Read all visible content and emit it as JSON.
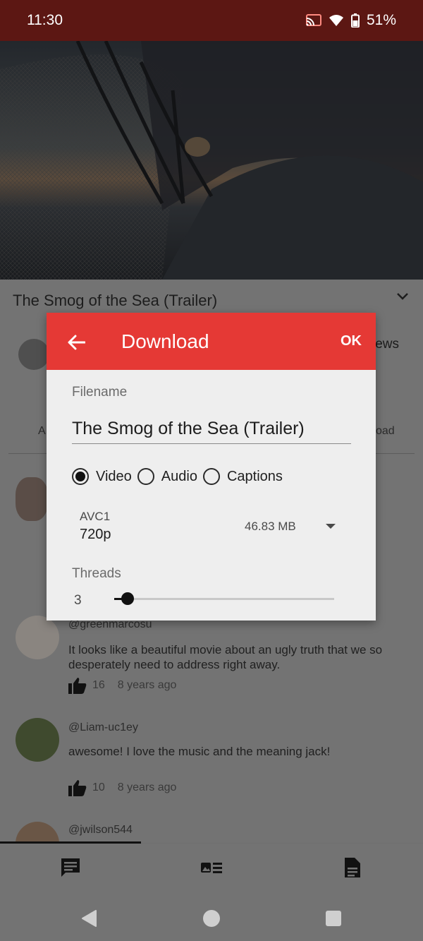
{
  "status_bar": {
    "time": "11:30",
    "battery": "51%",
    "icons": [
      "cast-icon",
      "wifi-icon",
      "battery-icon"
    ]
  },
  "video": {
    "title": "The Smog of the Sea (Trailer)",
    "views_fragment": "iews",
    "left_fragment": "A",
    "right_fragment": "oad"
  },
  "dialog": {
    "title": "Download",
    "ok_label": "OK",
    "filename_label": "Filename",
    "filename_value": "The Smog of the Sea (Trailer)",
    "radio_options": [
      "Video",
      "Audio",
      "Captions"
    ],
    "selected_option": "Video",
    "stream": {
      "codec": "AVC1",
      "quality": "720p",
      "size": "46.83 MB"
    },
    "threads_label": "Threads",
    "threads_value": "3",
    "threads_fraction": 0.06
  },
  "comments": [
    {
      "author": "@greenmarcosu",
      "text": "It looks like a beautiful movie about an ugly truth that we so desperately need to address right away.",
      "likes": "16",
      "time": "8 years ago"
    },
    {
      "author": "@Liam-uc1ey",
      "text": "awesome! I love the music and the meaning jack!",
      "likes": "10",
      "time": "8 years ago"
    },
    {
      "author": "@jwilson544"
    }
  ],
  "colors": {
    "status_bar": "#5c1713",
    "dialog_header": "#e53935",
    "dialog_body": "#eeeeee",
    "scrim": "#737373"
  },
  "bottom_tabs": [
    "comments-icon",
    "related-items-icon",
    "description-icon"
  ],
  "nav_bar": [
    "back-icon",
    "home-icon",
    "recents-icon"
  ]
}
